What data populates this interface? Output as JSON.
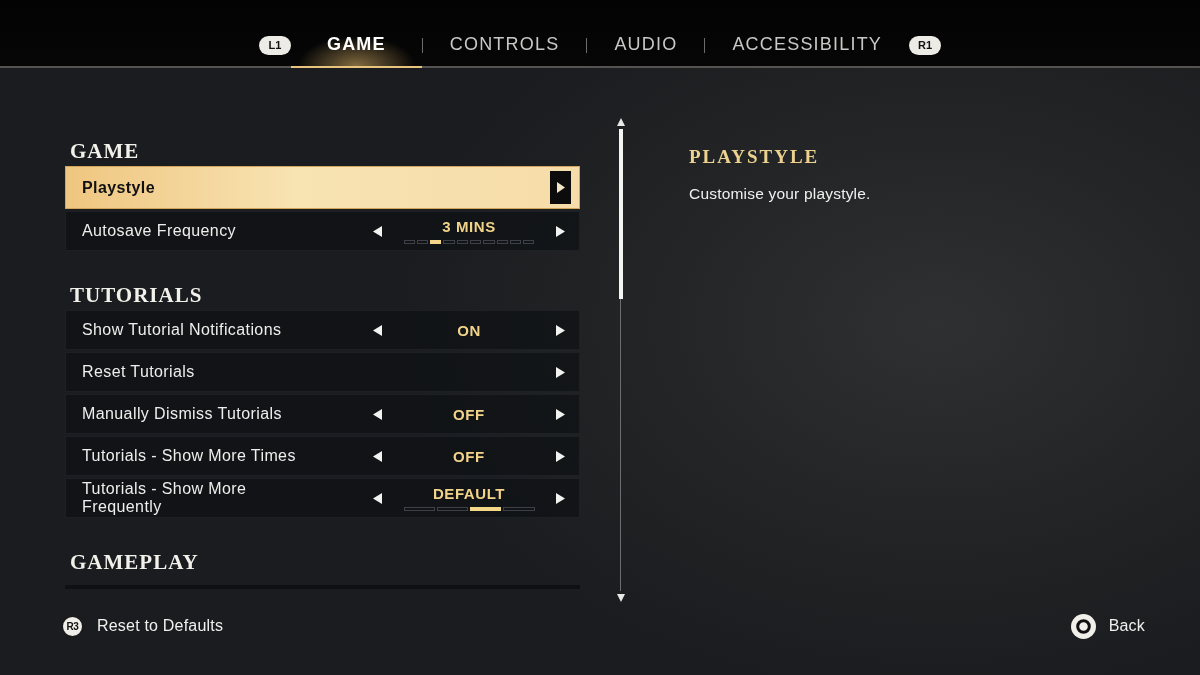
{
  "tabs": {
    "prev_bumper": "L1",
    "next_bumper": "R1",
    "items": [
      {
        "label": "GAME",
        "selected": true
      },
      {
        "label": "CONTROLS",
        "selected": false
      },
      {
        "label": "AUDIO",
        "selected": false
      },
      {
        "label": "ACCESSIBILITY",
        "selected": false
      }
    ]
  },
  "settings": {
    "sections": [
      {
        "title": "GAME",
        "items": [
          {
            "kind": "submenu",
            "label": "Playstyle",
            "selected": true
          },
          {
            "kind": "stepper",
            "label": "Autosave Frequency",
            "value": "3 MINS",
            "selected": false,
            "segments": [
              {
                "selected": false
              },
              {
                "selected": false
              },
              {
                "selected": true
              },
              {
                "selected": false
              },
              {
                "selected": false
              },
              {
                "selected": false
              },
              {
                "selected": false
              },
              {
                "selected": false
              },
              {
                "selected": false
              },
              {
                "selected": false
              }
            ]
          }
        ]
      },
      {
        "title": "TUTORIALS",
        "items": [
          {
            "kind": "stepper",
            "label": "Show Tutorial Notifications",
            "value": "ON",
            "selected": false
          },
          {
            "kind": "submenu",
            "label": "Reset Tutorials",
            "selected": false
          },
          {
            "kind": "stepper",
            "label": "Manually Dismiss Tutorials",
            "value": "OFF",
            "selected": false
          },
          {
            "kind": "stepper",
            "label": "Tutorials - Show More Times",
            "value": "OFF",
            "selected": false
          },
          {
            "kind": "stepper",
            "label": "Tutorials - Show More Frequently",
            "value": "DEFAULT",
            "selected": false,
            "segments": [
              {
                "selected": false
              },
              {
                "selected": false
              },
              {
                "selected": true
              },
              {
                "selected": false
              }
            ]
          }
        ]
      },
      {
        "title": "GAMEPLAY"
      }
    ]
  },
  "detail": {
    "title": "PLAYSTYLE",
    "description": "Customise your playstyle."
  },
  "footer": [
    {
      "kind": "prompt",
      "button": "R3",
      "label": "Reset to Defaults"
    },
    {
      "kind": "circle",
      "label": "Back"
    }
  ]
}
